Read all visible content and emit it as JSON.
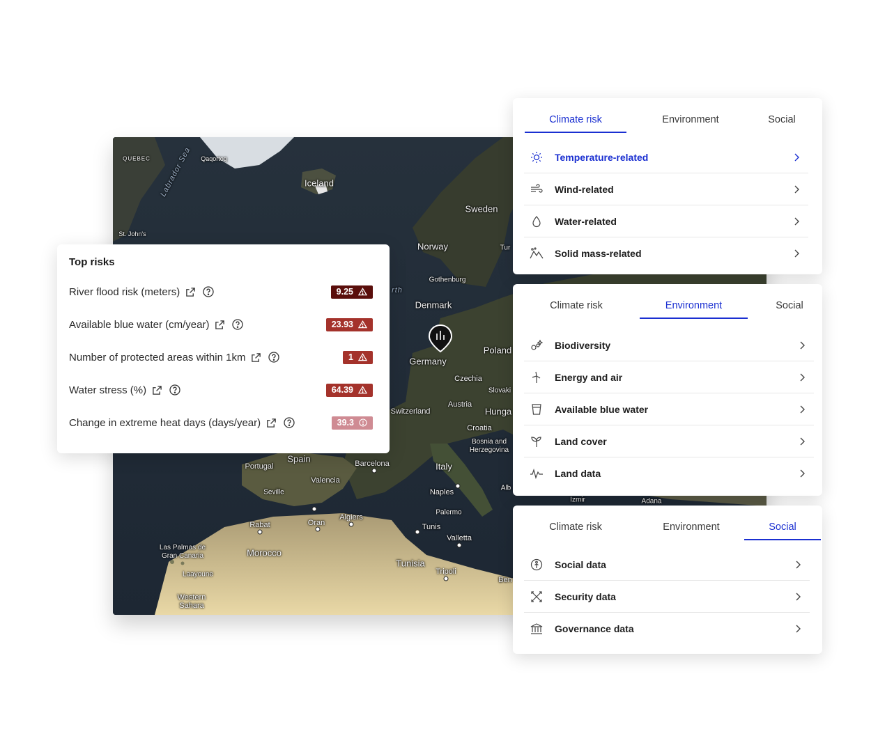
{
  "map": {
    "labels": {
      "quebec": "QUEBEC",
      "labrador": "Labrador Sea",
      "qaqortoq": "Qaqortoq",
      "iceland": "Iceland",
      "sweden": "Sweden",
      "stjohns": "St. John's",
      "norway": "Norway",
      "turkey": "Tur",
      "gothenburg": "Gothenburg",
      "denmark": "Denmark",
      "north_sea": "rth",
      "poland": "Poland",
      "germany": "Germany",
      "czechia": "Czechia",
      "slovakia": "Slovaki",
      "austria": "Austria",
      "switzerland": "Switzerland",
      "hungary": "Hunga",
      "croatia": "Croatia",
      "bosnia": "Bosnia and Herzegovina",
      "portugal": "Portugal",
      "spain": "Spain",
      "barcelona": "Barcelona",
      "italy": "Italy",
      "valencia": "Valencia",
      "seville": "Seville",
      "naples": "Naples",
      "albania": "Alb",
      "izmir": "Izmir",
      "adana": "Adana",
      "palermo": "Palermo",
      "rabat": "Rabat",
      "oran": "Oran",
      "algiers": "Algiers",
      "tunis": "Tunis",
      "valletta": "Valletta",
      "laspalmas": "Las Palmas de Gran Canaria",
      "morocco": "Morocco",
      "tunisia": "Tunisia",
      "tripoli": "Tripoli",
      "benghazi": "Ben",
      "laayoune": "Laayoune",
      "westernsahara": "Western Sahara"
    }
  },
  "top_risks": {
    "title": "Top risks",
    "rows": [
      {
        "label": "River flood risk (meters)",
        "value": "9.25",
        "color": "#5a0e0b",
        "icon": "warning-icon"
      },
      {
        "label": "Available blue water (cm/year)",
        "value": "23.93",
        "color": "#a4322b",
        "icon": "warning-icon"
      },
      {
        "label": "Number of protected areas within 1km",
        "value": "1",
        "color": "#a4322b",
        "icon": "warning-icon"
      },
      {
        "label": "Water stress (%)",
        "value": "64.39",
        "color": "#a4322b",
        "icon": "warning-icon"
      },
      {
        "label": "Change in extreme heat days (days/year)",
        "value": "39.3",
        "color": "#cf8b93",
        "icon": "info-circle-icon"
      }
    ]
  },
  "panels": {
    "tabs": [
      "Climate risk",
      "Environment",
      "Social"
    ],
    "climate": {
      "items": [
        {
          "label": "Temperature-related",
          "icon": "sun-icon"
        },
        {
          "label": "Wind-related",
          "icon": "wind-icon"
        },
        {
          "label": "Water-related",
          "icon": "droplet-icon"
        },
        {
          "label": "Solid mass-related",
          "icon": "landslide-icon"
        }
      ]
    },
    "environment": {
      "items": [
        {
          "label": "Biodiversity",
          "icon": "biodiversity-icon"
        },
        {
          "label": "Energy and air",
          "icon": "wind-turbine-icon"
        },
        {
          "label": "Available blue water",
          "icon": "water-glass-icon"
        },
        {
          "label": "Land cover",
          "icon": "sprout-icon"
        },
        {
          "label": "Land data",
          "icon": "pulse-icon"
        }
      ]
    },
    "social": {
      "items": [
        {
          "label": "Social data",
          "icon": "social-info-icon"
        },
        {
          "label": "Security data",
          "icon": "security-icon"
        },
        {
          "label": "Governance data",
          "icon": "bank-icon"
        }
      ]
    }
  }
}
